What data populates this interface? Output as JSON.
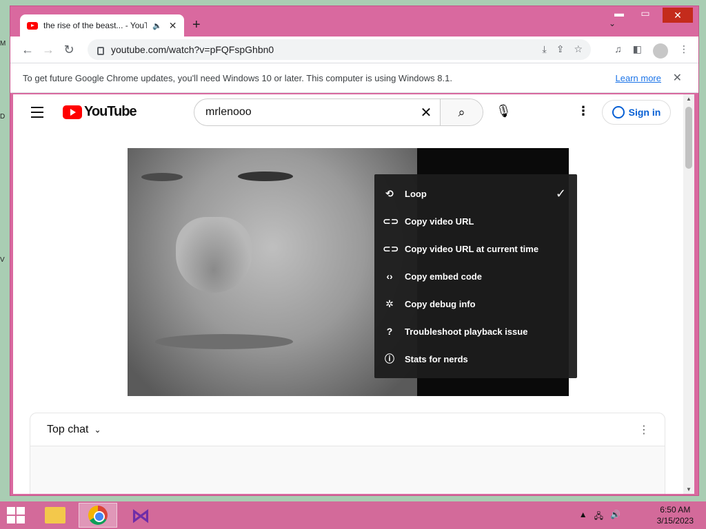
{
  "desktop": {
    "edge_letters": [
      "M",
      "D",
      "V"
    ]
  },
  "browser": {
    "tab_title": "the rise of the beast... - YouT",
    "new_tab_label": "+",
    "url": "youtube.com/watch?v=pFQFspGhbn0",
    "infobar_text": "To get future Google Chrome updates, you'll need Windows 10 or later. This computer is using Windows 8.1.",
    "infobar_link": "Learn more"
  },
  "youtube": {
    "logo_text": "YouTube",
    "search_query": "mrlenooo",
    "sign_in_label": "Sign in",
    "context_menu": [
      {
        "label": "Loop",
        "icon": "loop-icon",
        "checked": true
      },
      {
        "label": "Copy video URL",
        "icon": "link-icon",
        "checked": false
      },
      {
        "label": "Copy video URL at current time",
        "icon": "link-icon",
        "checked": false
      },
      {
        "label": "Copy embed code",
        "icon": "code-icon",
        "checked": false
      },
      {
        "label": "Copy debug info",
        "icon": "bug-icon",
        "checked": false
      },
      {
        "label": "Troubleshoot playback issue",
        "icon": "help-icon",
        "checked": false
      },
      {
        "label": "Stats for nerds",
        "icon": "info-icon",
        "checked": false
      }
    ],
    "chat_header": "Top chat"
  },
  "taskbar": {
    "time": "6:50 AM",
    "date": "3/15/2023"
  },
  "colors": {
    "window_frame": "#d9699f",
    "taskbar": "#d36a9a",
    "youtube_red": "#ff0000",
    "sign_in_blue": "#065fd4"
  }
}
